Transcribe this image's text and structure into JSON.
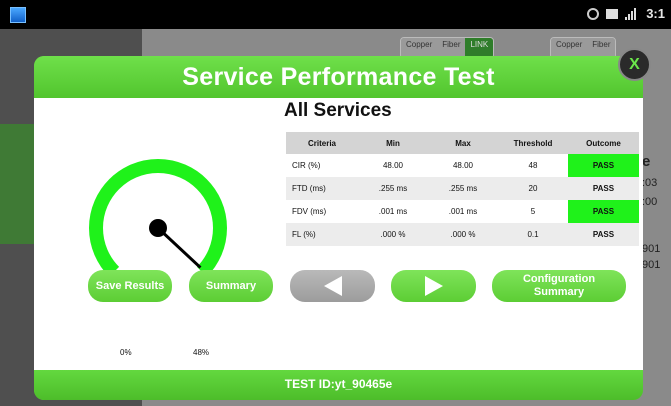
{
  "status_bar": {
    "time": "3:1",
    "icons": [
      "app-icon",
      "sync-icon",
      "screen-icon",
      "signal-icon"
    ]
  },
  "background_app": {
    "tab_groups": [
      {
        "labels": [
          "Copper",
          "Fiber",
          "LINK"
        ]
      },
      {
        "labels": [
          "Copper",
          "Fiber"
        ]
      }
    ],
    "side_values": [
      "e",
      ":03",
      ":00",
      "901",
      "901"
    ]
  },
  "dialog": {
    "title": "Service Performance Test",
    "close_label": "X",
    "subtitle": "All Services",
    "test_id": "TEST ID:yt_90465e"
  },
  "gauge": {
    "min_label": "0%",
    "max_label": "48%",
    "value_percent": 48,
    "color": "#1ff21a"
  },
  "table": {
    "headers": [
      "Criteria",
      "Min",
      "Max",
      "Threshold",
      "Outcome"
    ],
    "rows": [
      {
        "criteria": "CIR (%)",
        "min": "48.00",
        "max": "48.00",
        "threshold": "48",
        "outcome": "PASS"
      },
      {
        "criteria": "FTD (ms)",
        "min": ".255 ms",
        "max": ".255 ms",
        "threshold": "20",
        "outcome": "PASS"
      },
      {
        "criteria": "FDV (ms)",
        "min": ".001 ms",
        "max": ".001 ms",
        "threshold": "5",
        "outcome": "PASS"
      },
      {
        "criteria": "FL (%)",
        "min": ".000 %",
        "max": ".000 %",
        "threshold": "0.1",
        "outcome": "PASS"
      }
    ],
    "pass_color": "#1ff21a"
  },
  "buttons": {
    "save_results": "Save Results",
    "summary": "Summary",
    "prev_icon": "arrow-left-icon",
    "next_icon": "arrow-right-icon",
    "config_line1": "Configuration",
    "config_line2": "Summary"
  },
  "colors": {
    "accent_green": "#5fd43a",
    "pass_green": "#1ff21a"
  }
}
